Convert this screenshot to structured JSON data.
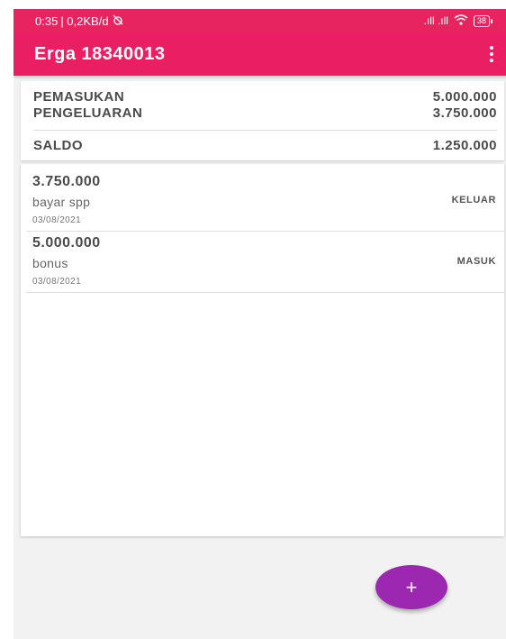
{
  "status_bar": {
    "time": "0:35",
    "net_speed": "| 0,2KB/d",
    "signal": ".ıll .ıll",
    "battery": "38"
  },
  "app_bar": {
    "title": "Erga 18340013",
    "menu_icon": "overflow-menu-icon"
  },
  "summary": {
    "income_label": "PEMASUKAN",
    "income_value": "5.000.000",
    "expense_label": "PENGELUARAN",
    "expense_value": "3.750.000",
    "balance_label": "SALDO",
    "balance_value": "1.250.000"
  },
  "transactions": [
    {
      "amount": "3.750.000",
      "description": "bayar spp",
      "date": "03/08/2021",
      "type": "KELUAR"
    },
    {
      "amount": "5.000.000",
      "description": "bonus",
      "date": "03/08/2021",
      "type": "MASUK"
    }
  ],
  "fab": {
    "label": "+",
    "icon": "add-icon"
  },
  "colors": {
    "status_bar": "#e7245f",
    "app_bar": "#e91e63",
    "fab": "#9c27b0",
    "background": "#f2f2f2"
  }
}
